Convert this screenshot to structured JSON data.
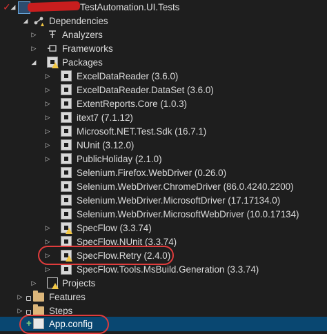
{
  "project": {
    "name": "TestAutomation.UI.Tests"
  },
  "dependencies": {
    "label": "Dependencies",
    "analyzers": "Analyzers",
    "frameworks": "Frameworks",
    "packages_label": "Packages",
    "packages": [
      "ExcelDataReader (3.6.0)",
      "ExcelDataReader.DataSet (3.6.0)",
      "ExtentReports.Core (1.0.3)",
      "itext7 (7.1.12)",
      "Microsoft.NET.Test.Sdk (16.7.1)",
      "NUnit (3.12.0)",
      "PublicHoliday (2.1.0)",
      "Selenium.Firefox.WebDriver (0.26.0)",
      "Selenium.WebDriver.ChromeDriver (86.0.4240.2200)",
      "Selenium.WebDriver.MicrosoftDriver (17.17134.0)",
      "Selenium.WebDriver.MicrosoftWebDriver (10.0.17134)",
      "SpecFlow (3.3.74)",
      "SpecFlow.NUnit (3.3.74)",
      "SpecFlow.Retry (2.4.0)",
      "SpecFlow.Tools.MsBuild.Generation (3.3.74)"
    ],
    "projects": "Projects"
  },
  "folders": {
    "features": "Features",
    "steps": "Steps"
  },
  "files": {
    "app_config": "App.config"
  },
  "colors": {
    "background": "#1e1e1e",
    "selection": "#094771",
    "highlight_circle": "#e03c3c",
    "warning": "#f2c744"
  }
}
